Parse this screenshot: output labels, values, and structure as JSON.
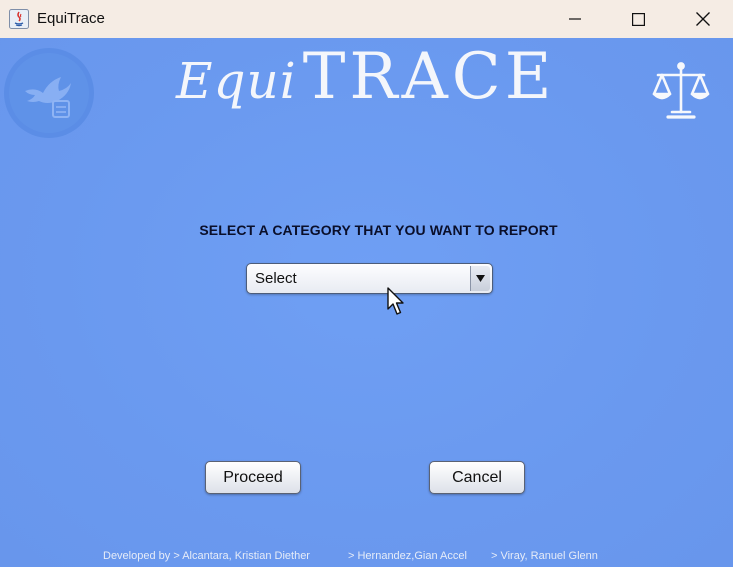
{
  "window": {
    "title": "EquiTrace",
    "controls": {
      "minimize_icon": "minimize-icon",
      "maximize_icon": "maximize-icon",
      "close_icon": "close-icon"
    }
  },
  "header": {
    "brand_part1": "Equi",
    "brand_part2": "TRACE",
    "left_logo": "dove-logo-icon",
    "right_logo": "scales-of-justice-icon"
  },
  "main": {
    "prompt": "SELECT A CATEGORY  THAT YOU WANT TO REPORT",
    "category_select": {
      "selected": "Select"
    },
    "proceed_label": "Proceed",
    "cancel_label": "Cancel"
  },
  "footer": {
    "credit_1": "Developed by > Alcantara, Kristian Diether",
    "credit_2": "> Hernandez,Gian Accel",
    "credit_3": "> Viray, Ranuel Glenn"
  },
  "colors": {
    "background": "#6b9af0",
    "titlebar": "#f5ece4",
    "brand_text": "#f4f6fb"
  }
}
